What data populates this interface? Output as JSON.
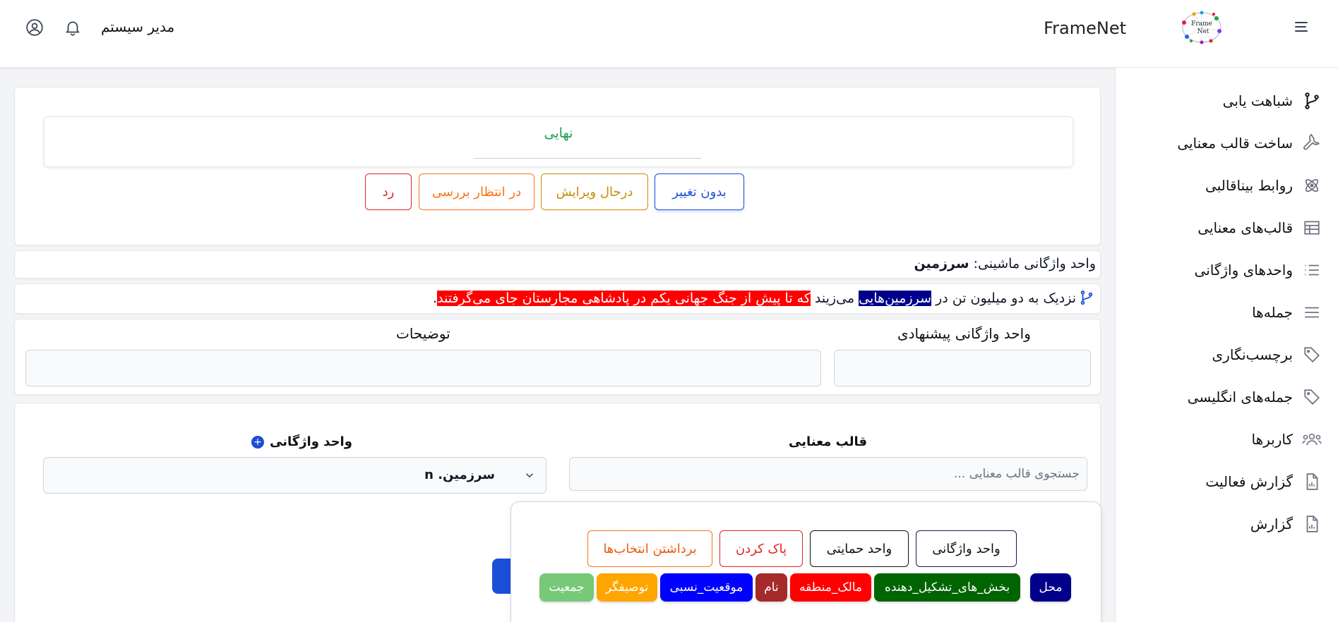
{
  "header": {
    "brand": "FrameNet",
    "user_name": "مدیر سیستم"
  },
  "sidebar": {
    "items": [
      {
        "label": "شباهت یابی",
        "icon": "git-branch-icon"
      },
      {
        "label": "ساخت قالب معنایی",
        "icon": "wrench-icon"
      },
      {
        "label": "روابط بیناقالبی",
        "icon": "atom-icon"
      },
      {
        "label": "قالب‌های معنایی",
        "icon": "table-icon"
      },
      {
        "label": "واحدهای واژگانی",
        "icon": "list-icon"
      },
      {
        "label": "جمله‌ها",
        "icon": "lines-icon"
      },
      {
        "label": "برچسب‌نگاری",
        "icon": "tag-icon"
      },
      {
        "label": "جمله‌های انگلیسی",
        "icon": "tag-icon"
      },
      {
        "label": "کاربرها",
        "icon": "users-icon"
      },
      {
        "label": "گزارش فعالیت",
        "icon": "report-icon"
      },
      {
        "label": "گزارش",
        "icon": "report-icon"
      }
    ]
  },
  "status": {
    "current": "نهایی",
    "buttons": {
      "unchanged": "بدون تغییر",
      "editing": "درحال ویرایش",
      "pending": "در انتظار بررسی",
      "reject": "رد"
    }
  },
  "machine_lu": {
    "label": "واحد واژگانی ماشینی:",
    "value": "سرزمین"
  },
  "sentence": {
    "part1": "نزدیک به دو میلیون تن در ",
    "target": "سرزمین‌هایی",
    "part2": " می‌زیند ",
    "highlight": "که تا پیش از جنگ جهانی یکم در پادشاهی مجارستان جای می‌گرفتند",
    "end": "."
  },
  "form": {
    "suggested_lu_label": "واحد واژگانی پیشنهادی",
    "notes_label": "توضیحات",
    "frame_label": "قالب معنایی",
    "frame_placeholder": "جستجوی قالب معنایی ...",
    "lu_label": "واحد واژگانی",
    "lu_value": "سرزمین. n",
    "partial_text": "... ... ..."
  },
  "popup": {
    "buttons": {
      "lexical_unit": "واحد واژگانی",
      "support_unit": "واحد حمایتی",
      "clear": "پاک کردن",
      "deselect": "برداشتن انتخاب‌ها"
    },
    "chips": [
      {
        "label": "محل",
        "color": "#00008b"
      },
      {
        "label": "بخش_های_تشکیل_دهنده",
        "color": "#006400"
      },
      {
        "label": "مالک_منطقه",
        "color": "#ff0000"
      },
      {
        "label": "نام",
        "color": "#a52a2a"
      },
      {
        "label": "موقعیت_نسبی",
        "color": "#0000ff"
      },
      {
        "label": "توصیفگر",
        "color": "#ffa500"
      },
      {
        "label": "جمعیت",
        "color": "#77c977"
      }
    ]
  },
  "colors": {
    "primary": "#1d4ed8",
    "status_final": "#16a34a",
    "btn_unchanged": "#1d4ed8",
    "btn_editing": "#ca8a04",
    "btn_pending": "#f97316",
    "btn_reject": "#dc2626",
    "target_bg": "#00008b",
    "highlight_bg": "#ff0000"
  }
}
